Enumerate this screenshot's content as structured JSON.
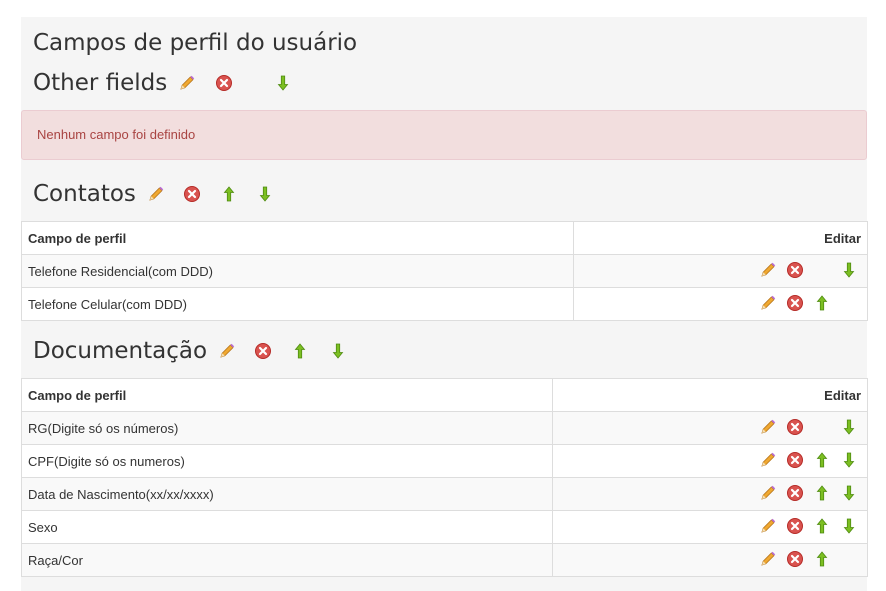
{
  "page": {
    "title": "Campos de perfil do usuário"
  },
  "icons": {
    "edit": "pencil-icon",
    "delete": "delete-icon",
    "up": "arrow-up-icon",
    "down": "arrow-down-icon"
  },
  "colors": {
    "alert_bg": "#f2dede",
    "alert_text": "#a94442",
    "delete_red": "#d9534f",
    "arrow_green": "#6aa51c"
  },
  "categories": [
    {
      "name": "Other fields",
      "empty_message": "Nenhum campo foi definido"
    },
    {
      "name": "Contatos",
      "table": {
        "headers": {
          "field": "Campo de perfil",
          "edit": "Editar"
        },
        "rows": [
          {
            "label": "Telefone Residencial(com DDD)"
          },
          {
            "label": "Telefone Celular(com DDD)"
          }
        ]
      }
    },
    {
      "name": "Documentação",
      "table": {
        "headers": {
          "field": "Campo de perfil",
          "edit": "Editar"
        },
        "rows": [
          {
            "label": "RG(Digite só os números)"
          },
          {
            "label": "CPF(Digite só os numeros)"
          },
          {
            "label": "Data de Nascimento(xx/xx/xxxx)"
          },
          {
            "label": "Sexo"
          },
          {
            "label": "Raça/Cor"
          }
        ]
      }
    }
  ]
}
